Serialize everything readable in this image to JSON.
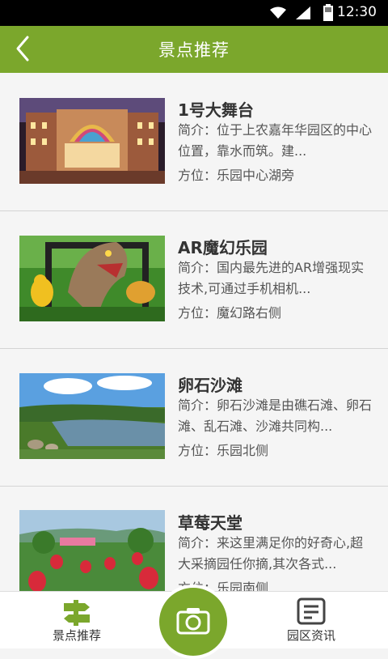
{
  "status_bar": {
    "time": "12:30"
  },
  "header": {
    "title": "景点推荐"
  },
  "attractions": [
    {
      "name": "1号大舞台",
      "intro": "简介：位于上农嘉年华园区的中心位置，靠水而筑。建...",
      "location": "方位：乐园中心湖旁"
    },
    {
      "name": "AR魔幻乐园",
      "intro": "简介：国内最先进的AR增强现实技术,可通过手机相机...",
      "location": "方位：魔幻路右侧"
    },
    {
      "name": "卵石沙滩",
      "intro": "简介：卵石沙滩是由礁石滩、卵石滩、乱石滩、沙滩共同构...",
      "location": "方位：乐园北侧"
    },
    {
      "name": "草莓天堂",
      "intro": "简介：来这里满足你的好奇心,超大采摘园任你摘,其次各式...",
      "location": "方位：乐园南侧"
    }
  ],
  "tabbar": {
    "left_label": "景点推荐",
    "right_label": "园区资讯"
  },
  "colors": {
    "accent": "#7ba72c"
  },
  "icons": {
    "back": "chevron-left-icon",
    "camera": "camera-icon",
    "signpost": "signpost-icon",
    "news": "document-icon"
  }
}
